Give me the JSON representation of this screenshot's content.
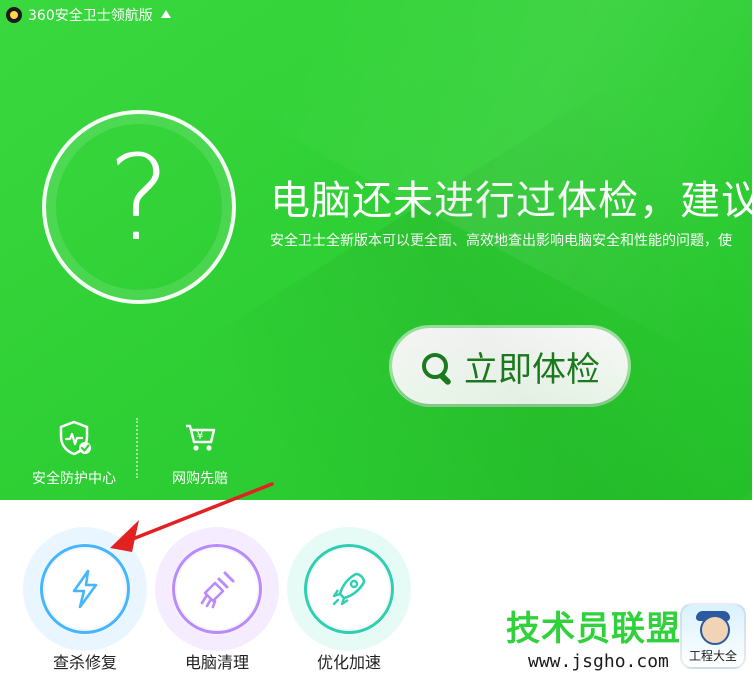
{
  "app": {
    "title": "360安全卫士领航版"
  },
  "hero": {
    "headline": "电脑还未进行过体检，建议立",
    "subline": "安全卫士全新版本可以更全面、高效地查出影响电脑安全和性能的问题，使",
    "status_symbol": "?"
  },
  "actions": {
    "scan_button": "立即体检"
  },
  "shortcuts": [
    {
      "label": "安全防护中心",
      "icon": "shield-monitor-icon"
    },
    {
      "label": "网购先赔",
      "icon": "cart-refund-icon"
    }
  ],
  "tools": [
    {
      "label": "查杀修复",
      "icon": "lightning-icon",
      "accent": "#46b6ff"
    },
    {
      "label": "电脑清理",
      "icon": "broom-icon",
      "accent": "#b88bff"
    },
    {
      "label": "优化加速",
      "icon": "rocket-icon",
      "accent": "#2fd0b2"
    }
  ],
  "overlay": {
    "arrow_color": "#e22222"
  },
  "watermark": {
    "text": "技术员联盟",
    "url": "www.jsgho.com",
    "badge_text": "工程大全"
  },
  "colors": {
    "hero_green": "#2fd035",
    "button_text_green": "#1c7f1f"
  }
}
